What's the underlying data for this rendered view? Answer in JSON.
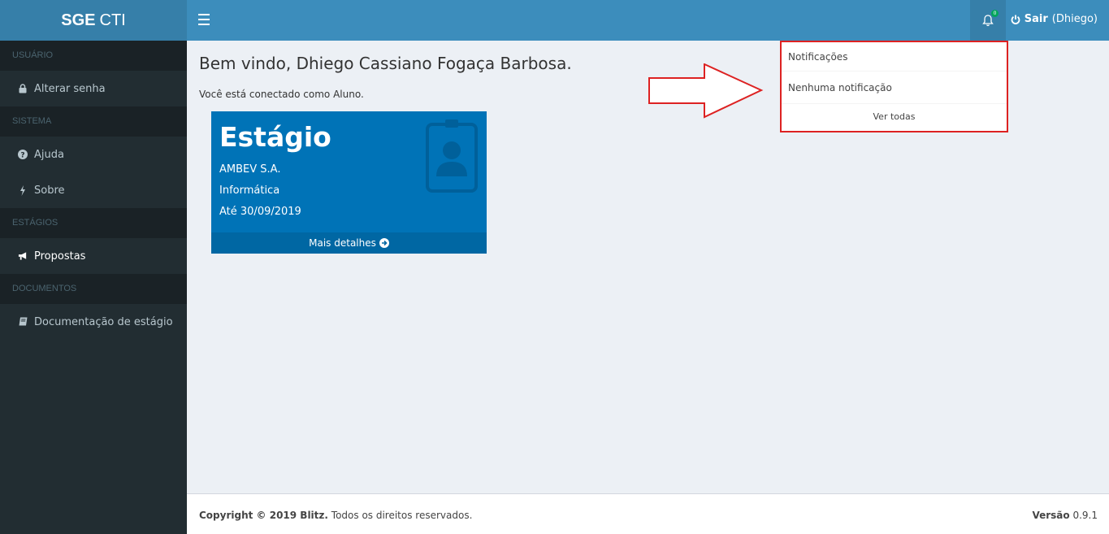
{
  "app": {
    "logo_bold": "SGE",
    "logo_rest": "CTI"
  },
  "header": {
    "notification_count": "0",
    "logout_label": "Sair",
    "logout_user": "(Dhiego)"
  },
  "sidebar": {
    "sections": [
      {
        "header": "USUÁRIO",
        "items": [
          {
            "label": "Alterar senha",
            "icon": "lock-icon"
          }
        ]
      },
      {
        "header": "SISTEMA",
        "items": [
          {
            "label": "Ajuda",
            "icon": "question-circle-icon"
          },
          {
            "label": "Sobre",
            "icon": "bolt-icon"
          }
        ]
      },
      {
        "header": "ESTÁGIOS",
        "items": [
          {
            "label": "Propostas",
            "icon": "bullhorn-icon"
          }
        ]
      },
      {
        "header": "DOCUMENTOS",
        "items": [
          {
            "label": "Documentação de estágio",
            "icon": "book-icon"
          }
        ]
      }
    ]
  },
  "main": {
    "welcome": "Bem vindo, Dhiego Cassiano Fogaça Barbosa.",
    "connected_as": "Você está conectado como Aluno.",
    "card": {
      "title": "Estágio",
      "company": "AMBEV S.A.",
      "area": "Informática",
      "until": "Até 30/09/2019",
      "footer_link": "Mais detalhes",
      "icon": "id-badge-icon"
    }
  },
  "notifications": {
    "header": "Notificações",
    "empty_message": "Nenhuma notificação",
    "view_all": "Ver todas"
  },
  "footer": {
    "copyright_bold": "Copyright © 2019 Blitz.",
    "copyright_rest": "Todos os direitos reservados.",
    "version_label": "Versão",
    "version_value": "0.9.1"
  },
  "colors": {
    "sidebar_bg": "#222d32",
    "header_bg": "#3c8dbc",
    "card_bg": "#0073b7",
    "badge_green": "#00a65a",
    "highlight_red": "#dd2222"
  }
}
